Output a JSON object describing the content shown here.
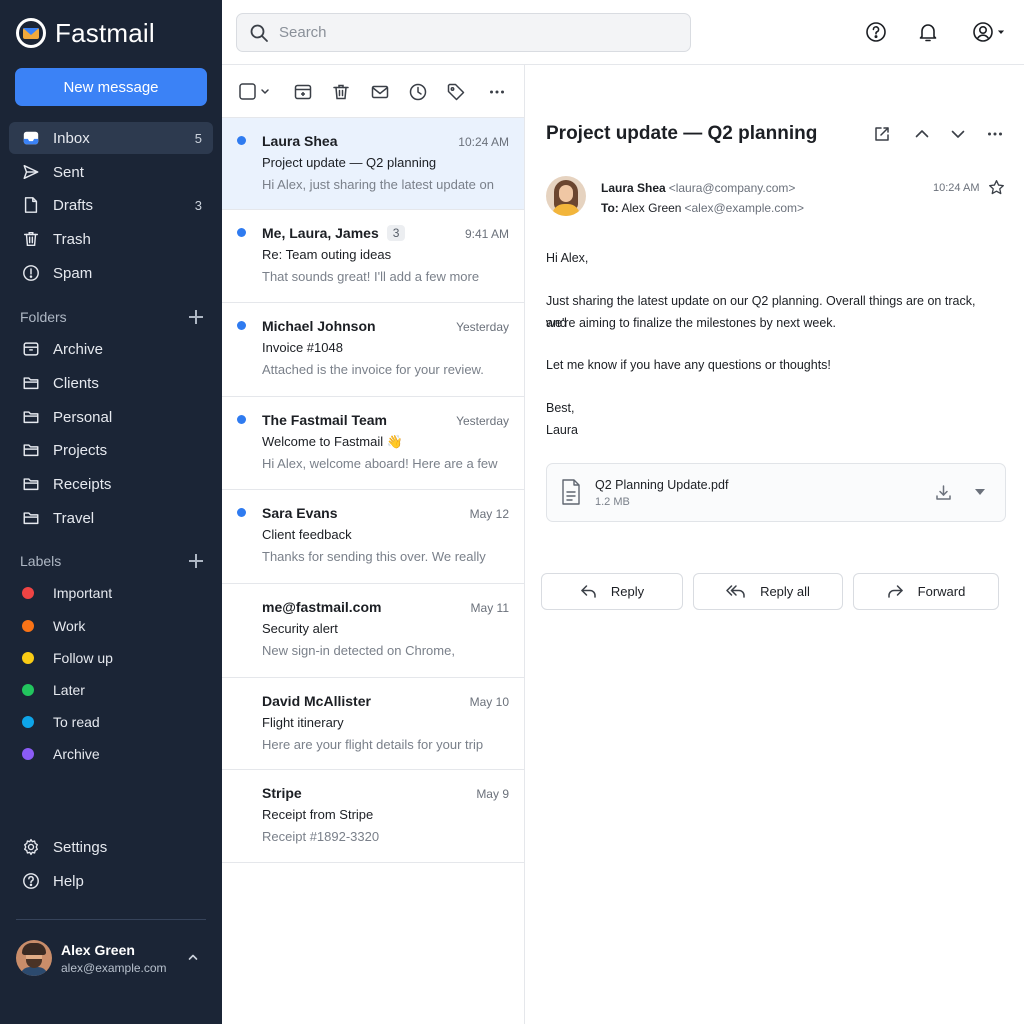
{
  "app": {
    "name": "Fastmail"
  },
  "sidebar": {
    "new_message": "New message",
    "mailboxes": [
      {
        "label": "Inbox",
        "count": "5",
        "icon": "inbox-icon"
      },
      {
        "label": "Sent",
        "count": "",
        "icon": "send-icon"
      },
      {
        "label": "Drafts",
        "count": "3",
        "icon": "draft-icon"
      },
      {
        "label": "Trash",
        "count": "",
        "icon": "trash-icon"
      },
      {
        "label": "Spam",
        "count": "",
        "icon": "spam-icon"
      }
    ],
    "folders_heading": "Folders",
    "folders": [
      "Archive",
      "Clients",
      "Personal",
      "Projects",
      "Receipts",
      "Travel"
    ],
    "labels_heading": "Labels",
    "labels": [
      {
        "label": "Important",
        "color": "#ef4444"
      },
      {
        "label": "Work",
        "color": "#f97316"
      },
      {
        "label": "Follow up",
        "color": "#facc15"
      },
      {
        "label": "Later",
        "color": "#22c55e"
      },
      {
        "label": "To read",
        "color": "#0ea5e9"
      },
      {
        "label": "Archive",
        "color": "#8b5cf6"
      }
    ],
    "settings": "Settings",
    "help": "Help",
    "user": {
      "name": "Alex Green",
      "email": "alex@example.com"
    }
  },
  "search": {
    "placeholder": "Search"
  },
  "messages": [
    {
      "sender": "Laura Shea",
      "thread": "",
      "time": "10:24 AM",
      "subject": "Project update — Q2 planning",
      "preview": "Hi Alex, just sharing the latest update on",
      "unread": true
    },
    {
      "sender": "Me, Laura, James",
      "thread": "3",
      "time": "9:41 AM",
      "subject": "Re: Team outing ideas",
      "preview": "That sounds great! I'll add a few more",
      "unread": true
    },
    {
      "sender": "Michael Johnson",
      "thread": "",
      "time": "Yesterday",
      "subject": "Invoice #1048",
      "preview": "Attached is the invoice for your review.",
      "unread": true
    },
    {
      "sender": "The Fastmail Team",
      "thread": "",
      "time": "Yesterday",
      "subject": "Welcome to Fastmail 👋",
      "preview": "Hi Alex, welcome aboard! Here are a few",
      "unread": true
    },
    {
      "sender": "Sara Evans",
      "thread": "",
      "time": "May 12",
      "subject": "Client feedback",
      "preview": "Thanks for sending this over. We really",
      "unread": true
    },
    {
      "sender": "me@fastmail.com",
      "thread": "",
      "time": "May 11",
      "subject": "Security alert",
      "preview": "New sign-in detected on Chrome,",
      "unread": false
    },
    {
      "sender": "David McAllister",
      "thread": "",
      "time": "May 10",
      "subject": "Flight itinerary",
      "preview": "Here are your flight details for your trip",
      "unread": false
    },
    {
      "sender": "Stripe",
      "thread": "",
      "time": "May 9",
      "subject": "Receipt from Stripe",
      "preview": "Receipt #1892-3320",
      "unread": false
    }
  ],
  "reader": {
    "title": "Project update — Q2 planning",
    "from_name": "Laura Shea",
    "from_addr": "<laura@company.com>",
    "to_label": "To:",
    "to_name": "Alex Green",
    "to_addr": "<alex@example.com>",
    "time": "10:24 AM",
    "body": {
      "greeting": "Hi Alex,",
      "p1a": "Just sharing the latest update on our Q2 planning. Overall things are on track, and",
      "p1b": "we're aiming to finalize the milestones by next week.",
      "p2": "Let me know if you have any questions or thoughts!",
      "sign1": "Best,",
      "sign2": "Laura"
    },
    "attachment": {
      "name": "Q2 Planning Update.pdf",
      "size": "1.2 MB"
    },
    "actions": {
      "reply": "Reply",
      "reply_all": "Reply all",
      "forward": "Forward"
    }
  }
}
